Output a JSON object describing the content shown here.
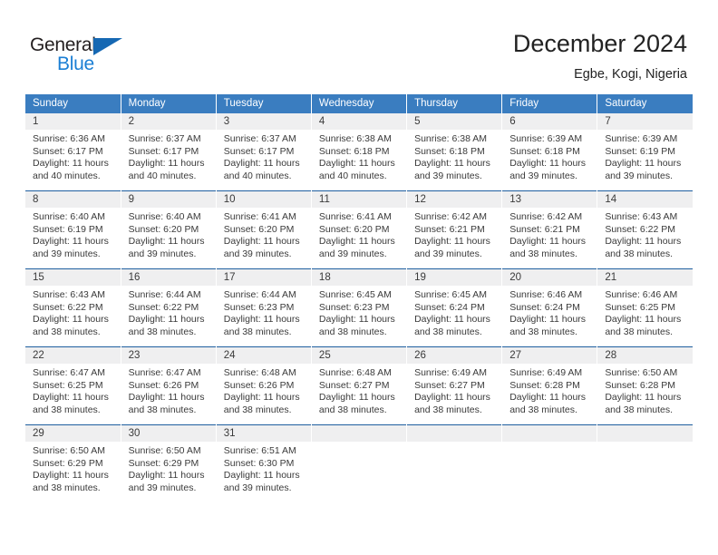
{
  "brand": {
    "name_top": "General",
    "name_bottom": "Blue",
    "triangle_color": "#1668b3",
    "blue_text_color": "#1b7fd4"
  },
  "header": {
    "title": "December 2024",
    "subtitle": "Egbe, Kogi, Nigeria"
  },
  "theme": {
    "header_blue": "#3a7dc0",
    "row_divider_blue": "#1f5fa0",
    "daynum_band": "#efeff0",
    "text": "#3a3a3a"
  },
  "weekday_headers": [
    "Sunday",
    "Monday",
    "Tuesday",
    "Wednesday",
    "Thursday",
    "Friday",
    "Saturday"
  ],
  "weeks": [
    [
      {
        "day": "1",
        "sunrise": "Sunrise: 6:36 AM",
        "sunset": "Sunset: 6:17 PM",
        "daylight1": "Daylight: 11 hours",
        "daylight2": "and 40 minutes."
      },
      {
        "day": "2",
        "sunrise": "Sunrise: 6:37 AM",
        "sunset": "Sunset: 6:17 PM",
        "daylight1": "Daylight: 11 hours",
        "daylight2": "and 40 minutes."
      },
      {
        "day": "3",
        "sunrise": "Sunrise: 6:37 AM",
        "sunset": "Sunset: 6:17 PM",
        "daylight1": "Daylight: 11 hours",
        "daylight2": "and 40 minutes."
      },
      {
        "day": "4",
        "sunrise": "Sunrise: 6:38 AM",
        "sunset": "Sunset: 6:18 PM",
        "daylight1": "Daylight: 11 hours",
        "daylight2": "and 40 minutes."
      },
      {
        "day": "5",
        "sunrise": "Sunrise: 6:38 AM",
        "sunset": "Sunset: 6:18 PM",
        "daylight1": "Daylight: 11 hours",
        "daylight2": "and 39 minutes."
      },
      {
        "day": "6",
        "sunrise": "Sunrise: 6:39 AM",
        "sunset": "Sunset: 6:18 PM",
        "daylight1": "Daylight: 11 hours",
        "daylight2": "and 39 minutes."
      },
      {
        "day": "7",
        "sunrise": "Sunrise: 6:39 AM",
        "sunset": "Sunset: 6:19 PM",
        "daylight1": "Daylight: 11 hours",
        "daylight2": "and 39 minutes."
      }
    ],
    [
      {
        "day": "8",
        "sunrise": "Sunrise: 6:40 AM",
        "sunset": "Sunset: 6:19 PM",
        "daylight1": "Daylight: 11 hours",
        "daylight2": "and 39 minutes."
      },
      {
        "day": "9",
        "sunrise": "Sunrise: 6:40 AM",
        "sunset": "Sunset: 6:20 PM",
        "daylight1": "Daylight: 11 hours",
        "daylight2": "and 39 minutes."
      },
      {
        "day": "10",
        "sunrise": "Sunrise: 6:41 AM",
        "sunset": "Sunset: 6:20 PM",
        "daylight1": "Daylight: 11 hours",
        "daylight2": "and 39 minutes."
      },
      {
        "day": "11",
        "sunrise": "Sunrise: 6:41 AM",
        "sunset": "Sunset: 6:20 PM",
        "daylight1": "Daylight: 11 hours",
        "daylight2": "and 39 minutes."
      },
      {
        "day": "12",
        "sunrise": "Sunrise: 6:42 AM",
        "sunset": "Sunset: 6:21 PM",
        "daylight1": "Daylight: 11 hours",
        "daylight2": "and 39 minutes."
      },
      {
        "day": "13",
        "sunrise": "Sunrise: 6:42 AM",
        "sunset": "Sunset: 6:21 PM",
        "daylight1": "Daylight: 11 hours",
        "daylight2": "and 38 minutes."
      },
      {
        "day": "14",
        "sunrise": "Sunrise: 6:43 AM",
        "sunset": "Sunset: 6:22 PM",
        "daylight1": "Daylight: 11 hours",
        "daylight2": "and 38 minutes."
      }
    ],
    [
      {
        "day": "15",
        "sunrise": "Sunrise: 6:43 AM",
        "sunset": "Sunset: 6:22 PM",
        "daylight1": "Daylight: 11 hours",
        "daylight2": "and 38 minutes."
      },
      {
        "day": "16",
        "sunrise": "Sunrise: 6:44 AM",
        "sunset": "Sunset: 6:22 PM",
        "daylight1": "Daylight: 11 hours",
        "daylight2": "and 38 minutes."
      },
      {
        "day": "17",
        "sunrise": "Sunrise: 6:44 AM",
        "sunset": "Sunset: 6:23 PM",
        "daylight1": "Daylight: 11 hours",
        "daylight2": "and 38 minutes."
      },
      {
        "day": "18",
        "sunrise": "Sunrise: 6:45 AM",
        "sunset": "Sunset: 6:23 PM",
        "daylight1": "Daylight: 11 hours",
        "daylight2": "and 38 minutes."
      },
      {
        "day": "19",
        "sunrise": "Sunrise: 6:45 AM",
        "sunset": "Sunset: 6:24 PM",
        "daylight1": "Daylight: 11 hours",
        "daylight2": "and 38 minutes."
      },
      {
        "day": "20",
        "sunrise": "Sunrise: 6:46 AM",
        "sunset": "Sunset: 6:24 PM",
        "daylight1": "Daylight: 11 hours",
        "daylight2": "and 38 minutes."
      },
      {
        "day": "21",
        "sunrise": "Sunrise: 6:46 AM",
        "sunset": "Sunset: 6:25 PM",
        "daylight1": "Daylight: 11 hours",
        "daylight2": "and 38 minutes."
      }
    ],
    [
      {
        "day": "22",
        "sunrise": "Sunrise: 6:47 AM",
        "sunset": "Sunset: 6:25 PM",
        "daylight1": "Daylight: 11 hours",
        "daylight2": "and 38 minutes."
      },
      {
        "day": "23",
        "sunrise": "Sunrise: 6:47 AM",
        "sunset": "Sunset: 6:26 PM",
        "daylight1": "Daylight: 11 hours",
        "daylight2": "and 38 minutes."
      },
      {
        "day": "24",
        "sunrise": "Sunrise: 6:48 AM",
        "sunset": "Sunset: 6:26 PM",
        "daylight1": "Daylight: 11 hours",
        "daylight2": "and 38 minutes."
      },
      {
        "day": "25",
        "sunrise": "Sunrise: 6:48 AM",
        "sunset": "Sunset: 6:27 PM",
        "daylight1": "Daylight: 11 hours",
        "daylight2": "and 38 minutes."
      },
      {
        "day": "26",
        "sunrise": "Sunrise: 6:49 AM",
        "sunset": "Sunset: 6:27 PM",
        "daylight1": "Daylight: 11 hours",
        "daylight2": "and 38 minutes."
      },
      {
        "day": "27",
        "sunrise": "Sunrise: 6:49 AM",
        "sunset": "Sunset: 6:28 PM",
        "daylight1": "Daylight: 11 hours",
        "daylight2": "and 38 minutes."
      },
      {
        "day": "28",
        "sunrise": "Sunrise: 6:50 AM",
        "sunset": "Sunset: 6:28 PM",
        "daylight1": "Daylight: 11 hours",
        "daylight2": "and 38 minutes."
      }
    ],
    [
      {
        "day": "29",
        "sunrise": "Sunrise: 6:50 AM",
        "sunset": "Sunset: 6:29 PM",
        "daylight1": "Daylight: 11 hours",
        "daylight2": "and 38 minutes."
      },
      {
        "day": "30",
        "sunrise": "Sunrise: 6:50 AM",
        "sunset": "Sunset: 6:29 PM",
        "daylight1": "Daylight: 11 hours",
        "daylight2": "and 39 minutes."
      },
      {
        "day": "31",
        "sunrise": "Sunrise: 6:51 AM",
        "sunset": "Sunset: 6:30 PM",
        "daylight1": "Daylight: 11 hours",
        "daylight2": "and 39 minutes."
      },
      {
        "day": "",
        "sunrise": "",
        "sunset": "",
        "daylight1": "",
        "daylight2": ""
      },
      {
        "day": "",
        "sunrise": "",
        "sunset": "",
        "daylight1": "",
        "daylight2": ""
      },
      {
        "day": "",
        "sunrise": "",
        "sunset": "",
        "daylight1": "",
        "daylight2": ""
      },
      {
        "day": "",
        "sunrise": "",
        "sunset": "",
        "daylight1": "",
        "daylight2": ""
      }
    ]
  ]
}
